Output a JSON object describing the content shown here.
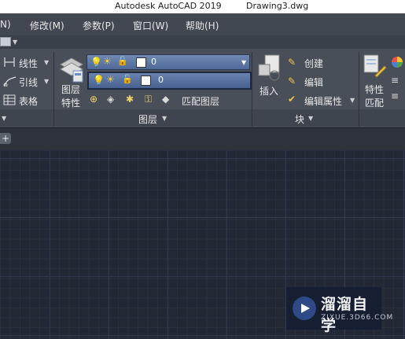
{
  "titlebar": {
    "app": "Autodesk AutoCAD 2019",
    "document": "Drawing3.dwg"
  },
  "menu": {
    "items": [
      "N)",
      "修改(M)",
      "参数(P)",
      "窗口(W)",
      "帮助(H)"
    ]
  },
  "ribbon": {
    "annotation": {
      "linear": "线性",
      "leader": "引线",
      "table": "表格"
    },
    "layers": {
      "properties_label_1": "图层",
      "properties_label_2": "特性",
      "layer_dropdown_value": "0",
      "layer_list_value": "0",
      "match_layer": "匹配图层",
      "panel_title": "图层"
    },
    "block": {
      "insert": "插入",
      "create": "创建",
      "edit": "编辑",
      "edit_attributes": "编辑属性",
      "panel_title": "块"
    },
    "properties": {
      "match_label_1": "特性",
      "match_label_2": "匹配"
    }
  },
  "tabs": {
    "add": "+"
  },
  "watermark": {
    "title": "溜溜自学",
    "site": "ZIXUE.3D66.COM"
  },
  "colors": {
    "menubar": "#414852",
    "ribbon": "#494f58",
    "canvas": "#222935",
    "layer_dropdown": "#5b77a6"
  }
}
